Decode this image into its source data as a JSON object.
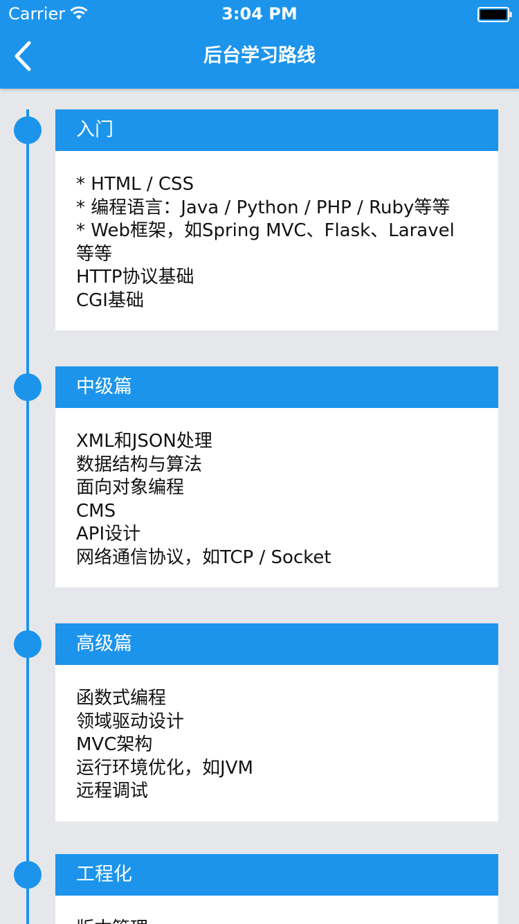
{
  "status_bar": {
    "carrier": "Carrier",
    "time": "3:04 PM"
  },
  "nav": {
    "title": "后台学习路线",
    "back_icon": "chevron-left-icon"
  },
  "colors": {
    "accent": "#1c94ec",
    "background": "#e6e7ea",
    "card": "#ffffff",
    "text": "#111111"
  },
  "sections": [
    {
      "title": "入门",
      "lines": [
        "* HTML / CSS",
        "* 编程语言：Java / Python / PHP / Ruby等等",
        "* Web框架，如Spring MVC、Flask、Laravel",
        "等等",
        "HTTP协议基础",
        "CGI基础"
      ]
    },
    {
      "title": "中级篇",
      "lines": [
        "XML和JSON处理",
        "数据结构与算法",
        "面向对象编程",
        "CMS",
        "API设计",
        "网络通信协议，如TCP / Socket"
      ]
    },
    {
      "title": "高级篇",
      "lines": [
        "函数式编程",
        "领域驱动设计",
        "MVC架构",
        "运行环境优化，如JVM",
        "远程调试"
      ]
    },
    {
      "title": "工程化",
      "lines": [
        "版本管理"
      ]
    }
  ]
}
